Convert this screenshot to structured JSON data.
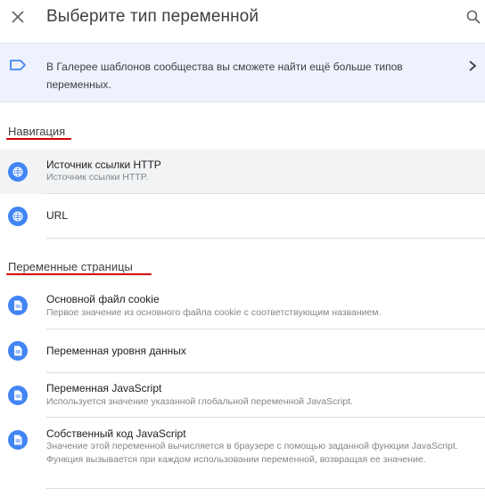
{
  "header": {
    "title": "Выберите тип переменной",
    "close_icon": "close-icon",
    "search_icon": "search-icon"
  },
  "banner": {
    "text": "В Галерее шаблонов сообщества вы сможете найти ещё больше типов переменных.",
    "tag_icon": "tag-icon",
    "chevron_icon": "chevron-right-icon",
    "background": "#edf2fc"
  },
  "sections": [
    {
      "title": "Навигация",
      "items": [
        {
          "title": "Источник ссылки HTTP",
          "description": "Источник ссылки HTTP.",
          "icon": "globe-icon"
        },
        {
          "title": "URL",
          "description": "",
          "icon": "globe-icon"
        }
      ]
    },
    {
      "title": "Переменные страницы",
      "items": [
        {
          "title": "Основной файл cookie",
          "description": "Первое значение из основного файла cookie с соответствующим названием.",
          "icon": "document-icon"
        },
        {
          "title": "Переменная уровня данных",
          "description": "",
          "icon": "document-icon"
        },
        {
          "title": "Переменная JavaScript",
          "description": "Используется значение указанной глобальной переменной JavaScript.",
          "icon": "document-icon"
        },
        {
          "title": "Собственный код JavaScript",
          "description": "Значение этой переменной вычисляется в браузере с помощью заданной функции JavaScript. Функция вызывается при каждом использовании переменной, возвращая ее значение.",
          "icon": "document-icon"
        }
      ]
    }
  ],
  "colors": {
    "accent": "#4285f4",
    "annotation_underline": "#d50000",
    "selected_row": "#f1f3f4"
  }
}
